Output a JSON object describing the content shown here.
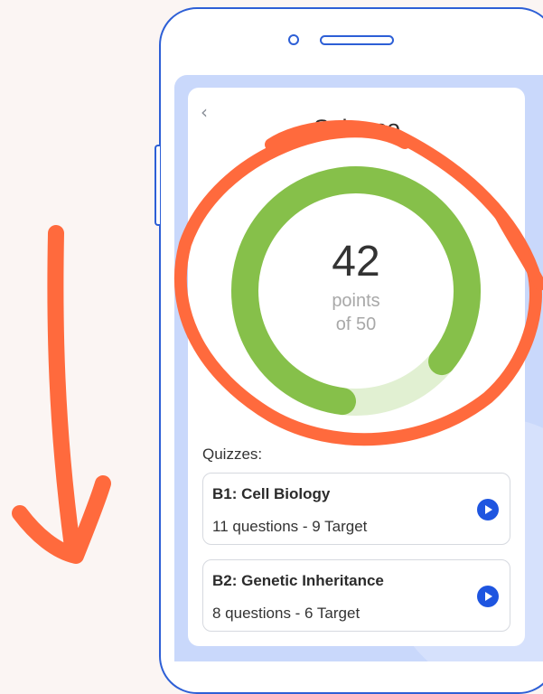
{
  "screen": {
    "title": "Science",
    "back_icon": "chevron-left-icon"
  },
  "score": {
    "value": "42",
    "line1": "points",
    "line2": "of 50",
    "points": 42,
    "total": 50,
    "progress_color": "#86c04a",
    "track_color": "#e1f0d2"
  },
  "quizzes": {
    "heading": "Quizzes:",
    "items": [
      {
        "title": "B1: Cell Biology",
        "meta": "11 questions - 9 Target",
        "icon": "play-icon"
      },
      {
        "title": "B2: Genetic Inheritance",
        "meta": "8 questions - 6 Target",
        "icon": "play-icon"
      }
    ]
  },
  "colors": {
    "frame": "#2d5fd6",
    "accent": "#1e55e0",
    "annotation": "#ff6a3d",
    "background": "#fbf5f3"
  }
}
